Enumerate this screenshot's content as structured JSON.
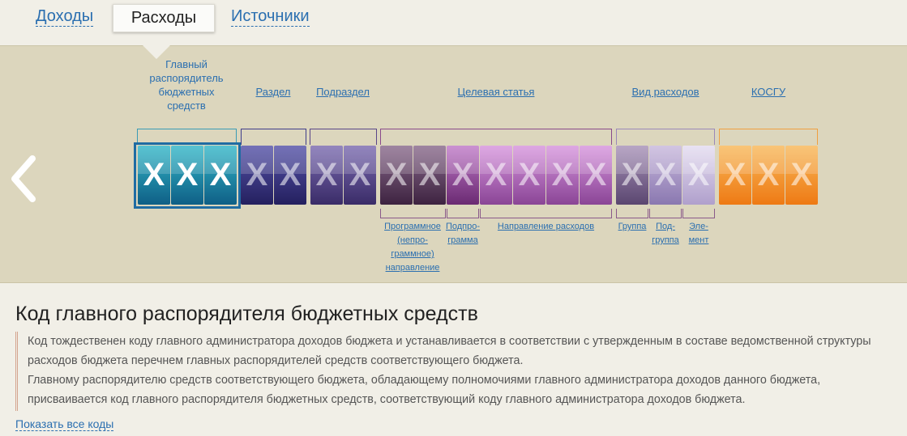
{
  "tabs": [
    {
      "label": "Доходы",
      "active": false
    },
    {
      "label": "Расходы",
      "active": true
    },
    {
      "label": "Источники",
      "active": false
    }
  ],
  "segments": [
    {
      "label": "Главный распорядитель бюджетных средств",
      "lines": [
        "Главный",
        "распорядитель",
        "бюджетных",
        "средств"
      ],
      "color": "#1c7fa3",
      "active": true
    },
    {
      "label": "Раздел",
      "color": "#3f3d8a"
    },
    {
      "label": "Подраздел",
      "color": "#5a4688"
    },
    {
      "label": "Целевая статья",
      "color": "#9a4f9f"
    },
    {
      "label": "Вид расходов",
      "color": "#9f8abc"
    },
    {
      "label": "КОСГУ",
      "color": "#f08a1e"
    }
  ],
  "tile_glyph": "X",
  "sub_labels": [
    {
      "lines": [
        "Программное",
        "(непро-",
        "граммное)",
        "направление"
      ]
    },
    {
      "lines": [
        "Подпро-",
        "грамма"
      ]
    },
    {
      "lines": [
        "Направление расходов"
      ]
    },
    {
      "lines": [
        "Группа"
      ]
    },
    {
      "lines": [
        "Под-",
        "группа"
      ]
    },
    {
      "lines": [
        "Эле-",
        "мент"
      ]
    }
  ],
  "content": {
    "title": "Код главного распорядителя бюджетных средств",
    "paragraph_lines": [
      "Код тождественен коду главного администратора доходов бюджета и устанавливается в соответствии с утвержденным в составе ведомственной структуры",
      "расходов бюджета перечнем главных распорядителей средств соответствующего бюджета.",
      "Главному распорядителю средств соответствующего бюджета, обладающему полномочиями главного администратора доходов данного бюджета,",
      "присваивается код главного распорядителя бюджетных средств, соответствующий коду главного администратора доходов бюджета."
    ],
    "show_all_link": "Показать все коды"
  }
}
